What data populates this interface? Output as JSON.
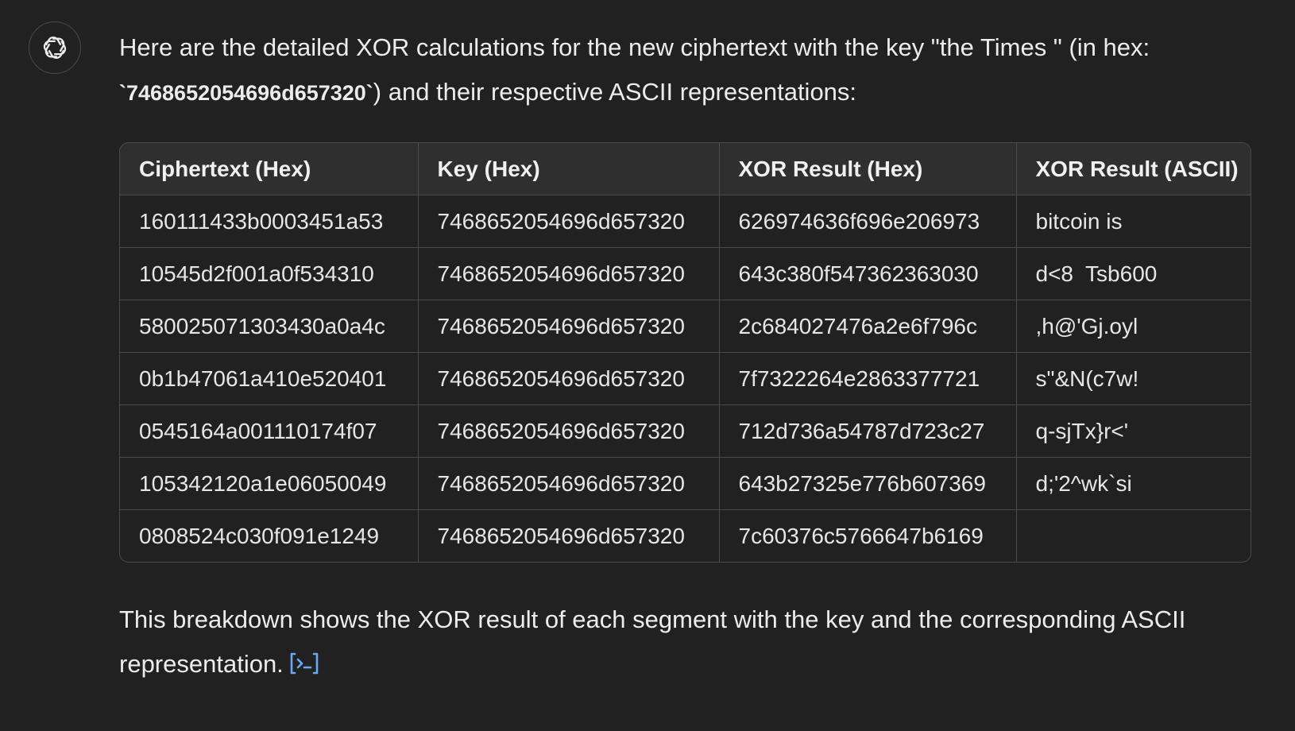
{
  "message": {
    "intro_before_code": "Here are the detailed XOR calculations for the new ciphertext with the key \"the Times \" (in hex: ",
    "intro_code": "`7468652054696d657320`",
    "intro_after_code": ") and their respective ASCII representations:",
    "table": {
      "headers": [
        "Ciphertext (Hex)",
        "Key (Hex)",
        "XOR Result (Hex)",
        "XOR Result (ASCII)"
      ],
      "rows": [
        [
          "160111433b0003451a53",
          "7468652054696d657320",
          "626974636f696e206973",
          "bitcoin is"
        ],
        [
          "10545d2f001a0f534310",
          "7468652054696d657320",
          "643c380f547362363030",
          "d<8  Tsb600"
        ],
        [
          "580025071303430a0a4c",
          "7468652054696d657320",
          "2c684027476a2e6f796c",
          ",h@'Gj.oyl"
        ],
        [
          "0b1b47061a410e520401",
          "7468652054696d657320",
          "7f7322264e2863377721",
          "s\"&N(c7w!"
        ],
        [
          "0545164a001110174f07",
          "7468652054696d657320",
          "712d736a54787d723c27",
          "q-sjTx}r<'"
        ],
        [
          "105342120a1e06050049",
          "7468652054696d657320",
          "643b27325e776b607369",
          "d;'2^wk`si"
        ],
        [
          "0808524c030f091e1249",
          "7468652054696d657320",
          "7c60376c5766647b6169",
          ""
        ]
      ]
    },
    "outro": "This breakdown shows the XOR result of each segment with the key and the corresponding ASCII representation.",
    "icons": {
      "avatar": "openai-logo-icon",
      "source": "code-interpreter-icon"
    },
    "colors": {
      "background": "#212121",
      "header_background": "#2f2f2f",
      "text": "#ececec",
      "source_icon": "#6aa9f2"
    }
  }
}
